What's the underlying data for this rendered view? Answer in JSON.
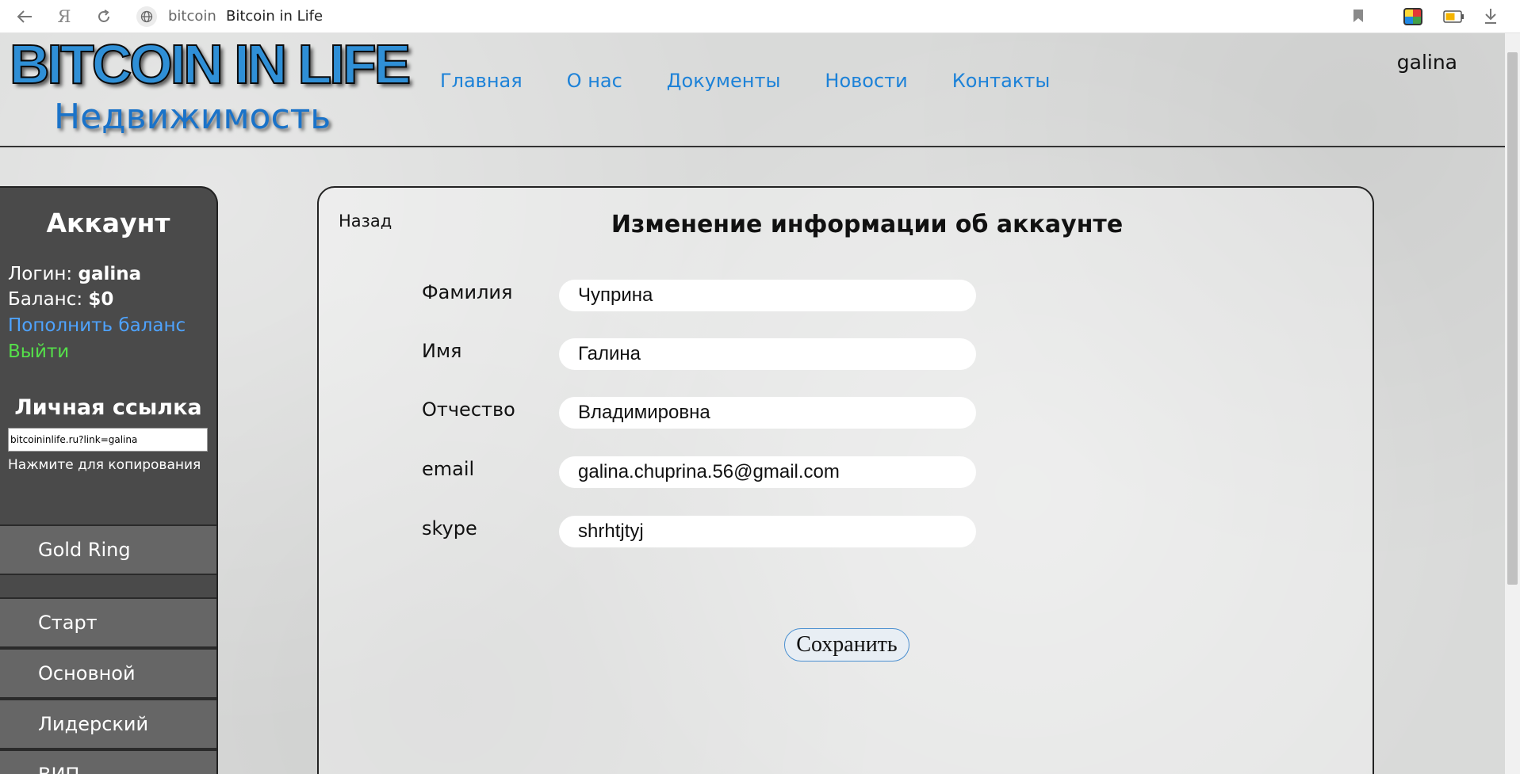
{
  "browser": {
    "url_domain": "bitcoin",
    "page_title": "Bitcoin in Life",
    "ya_label": "Я"
  },
  "header": {
    "logo_text": "BITCOIN IN LIFE",
    "logo_subtitle": "Недвижимость",
    "nav": [
      "Главная",
      "О нас",
      "Документы",
      "Новости",
      "Контакты"
    ],
    "username": "galina"
  },
  "sidebar": {
    "title": "Аккаунт",
    "login_label": "Логин: ",
    "login_value": "galina",
    "balance_label": "Баланс: ",
    "balance_value": "$0",
    "topup_link": "Пополнить баланс",
    "logout_link": "Выйти",
    "ref_title": "Личная ссылка",
    "ref_value": "bitcoininlife.ru?link=galina",
    "ref_hint": "Нажмите для копирования",
    "menu": [
      "Gold Ring",
      "Старт",
      "Основной",
      "Лидерский",
      "ВИП"
    ]
  },
  "form": {
    "back_link": "Назад",
    "title": "Изменение информации об аккаунте",
    "fields": [
      {
        "label": "Фамилия",
        "value": "Чуприна"
      },
      {
        "label": "Имя",
        "value": "Галина"
      },
      {
        "label": "Отчество",
        "value": "Владимировна"
      },
      {
        "label": "email",
        "value": "galina.chuprina.56@gmail.com"
      },
      {
        "label": "skype",
        "value": "shrhtjtyj"
      }
    ],
    "save_label": "Сохранить"
  }
}
